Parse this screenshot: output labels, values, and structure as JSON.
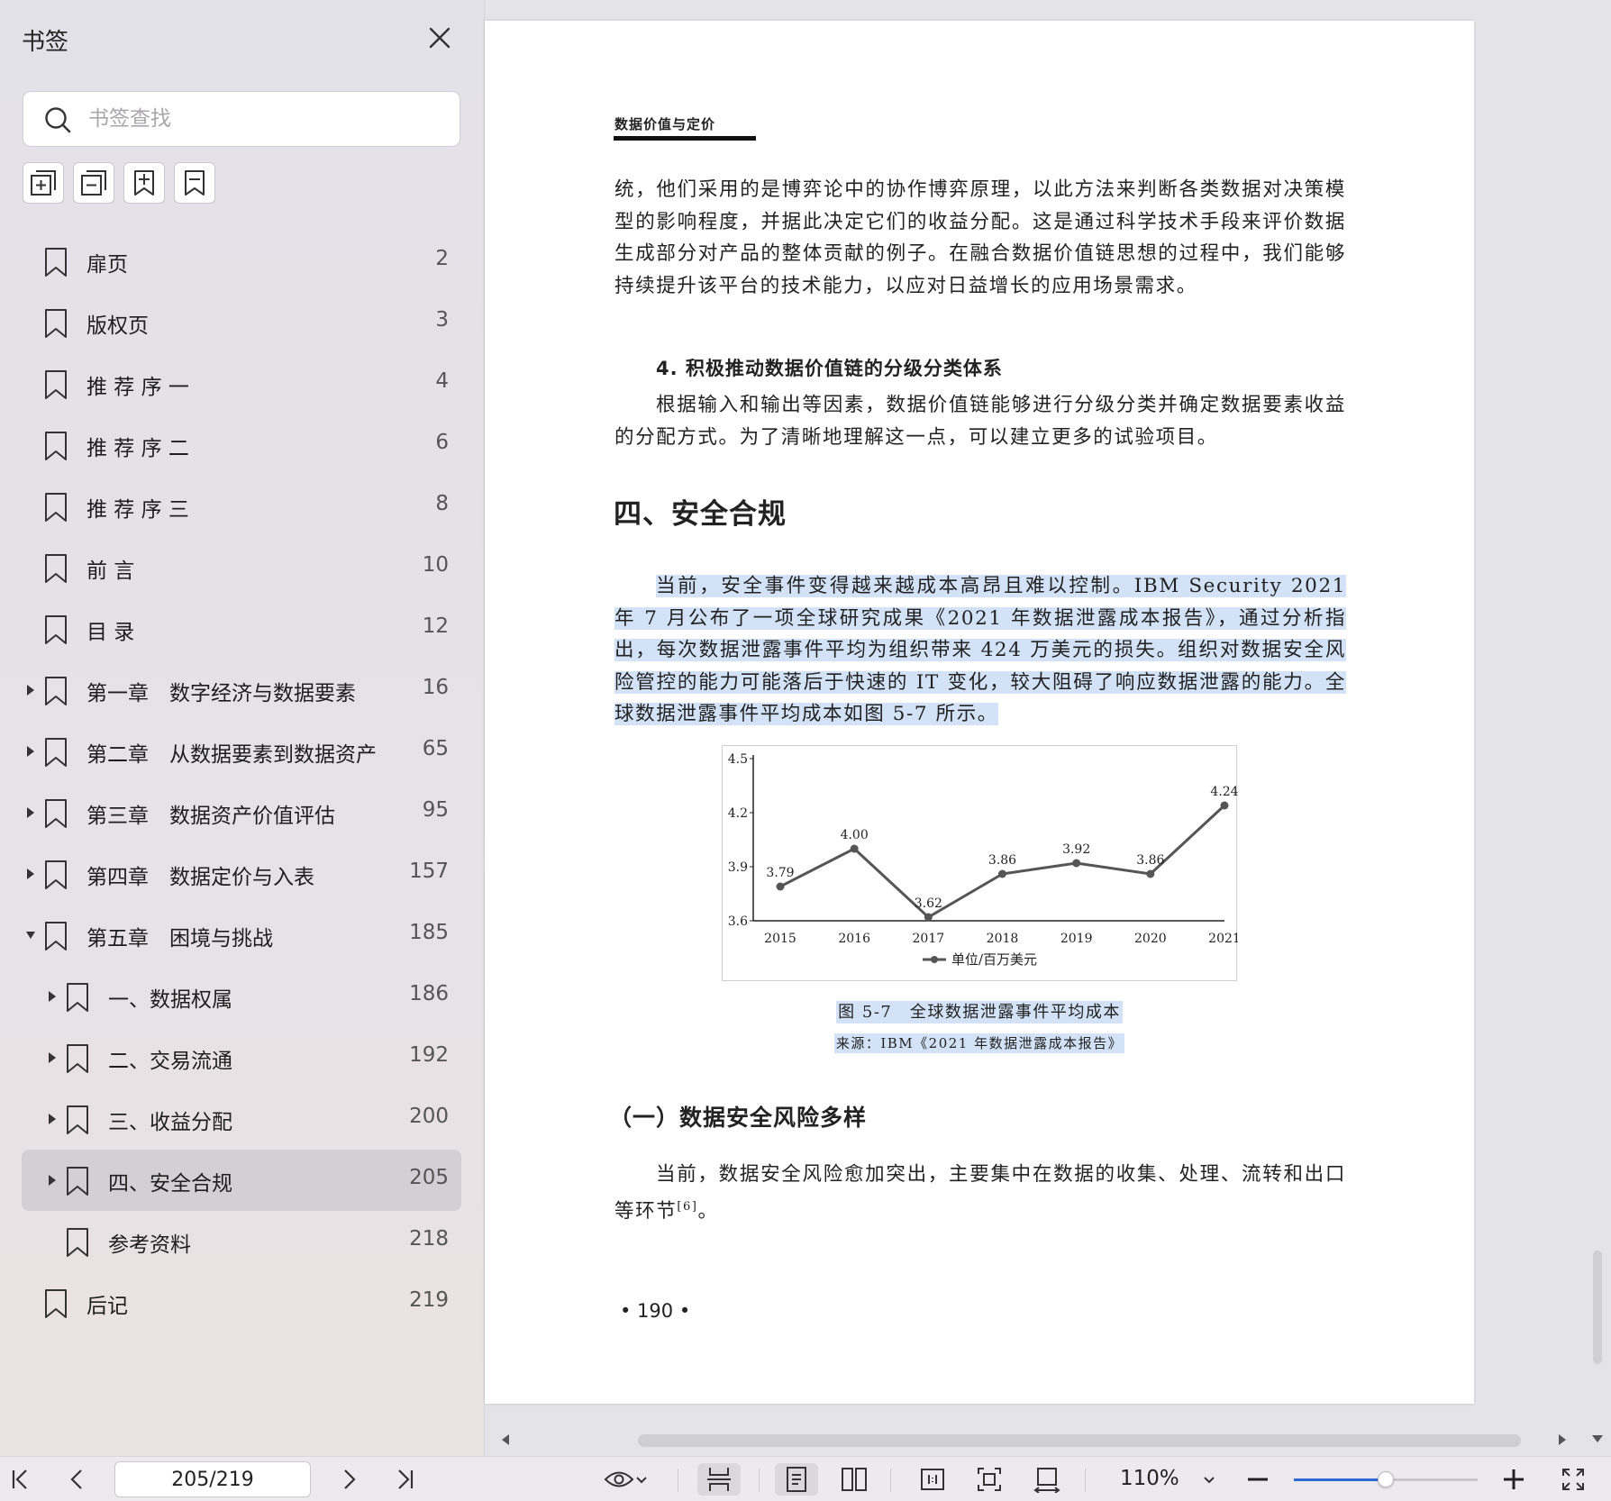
{
  "sidebar": {
    "title": "书签",
    "search_placeholder": "书签查找",
    "bookmarks": [
      {
        "label": "扉页",
        "page": "2",
        "level": 0,
        "arrow": "none"
      },
      {
        "label": "版权页",
        "page": "3",
        "level": 0,
        "arrow": "none"
      },
      {
        "label": "推 荐 序 一",
        "page": "4",
        "level": 0,
        "arrow": "none"
      },
      {
        "label": "推 荐 序 二",
        "page": "6",
        "level": 0,
        "arrow": "none"
      },
      {
        "label": "推 荐 序 三",
        "page": "8",
        "level": 0,
        "arrow": "none"
      },
      {
        "label": "前 言",
        "page": "10",
        "level": 0,
        "arrow": "none"
      },
      {
        "label": "目 录",
        "page": "12",
        "level": 0,
        "arrow": "none"
      },
      {
        "label": "第一章　数字经济与数据要素",
        "page": "16",
        "level": 0,
        "arrow": "right"
      },
      {
        "label": "第二章　从数据要素到数据资产",
        "page": "65",
        "level": 0,
        "arrow": "right"
      },
      {
        "label": "第三章　数据资产价值评估",
        "page": "95",
        "level": 0,
        "arrow": "right"
      },
      {
        "label": "第四章　数据定价与入表",
        "page": "157",
        "level": 0,
        "arrow": "right"
      },
      {
        "label": "第五章　困境与挑战",
        "page": "185",
        "level": 0,
        "arrow": "down"
      },
      {
        "label": "一、数据权属",
        "page": "186",
        "level": 1,
        "arrow": "right"
      },
      {
        "label": "二、交易流通",
        "page": "192",
        "level": 1,
        "arrow": "right"
      },
      {
        "label": "三、收益分配",
        "page": "200",
        "level": 1,
        "arrow": "right"
      },
      {
        "label": "四、安全合规",
        "page": "205",
        "level": 1,
        "arrow": "right",
        "selected": true
      },
      {
        "label": "参考资料",
        "page": "218",
        "level": 1,
        "arrow": "none"
      },
      {
        "label": "后记",
        "page": "219",
        "level": 0,
        "arrow": "none"
      }
    ]
  },
  "document": {
    "running_head": "数据价值与定价",
    "para1": "统，他们采用的是博弈论中的协作博弈原理，以此方法来判断各类数据对决策模型的影响程度，并据此决定它们的收益分配。这是通过科学技术手段来评价数据生成部分对产品的整体贡献的例子。在融合数据价值链思想的过程中，我们能够持续提升该平台的技术能力，以应对日益增长的应用场景需求。",
    "sub_heading_4": "4.  积极推动数据价值链的分级分类体系",
    "para2": "根据输入和输出等因素，数据价值链能够进行分级分类并确定数据要素收益的分配方式。为了清晰地理解这一点，可以建立更多的试验项目。",
    "section_heading": "四、安全合规",
    "para3": "当前，安全事件变得越来越成本高昂且难以控制。IBM Security 2021 年 7 月公布了一项全球研究成果《2021 年数据泄露成本报告》，通过分析指出，每次数据泄露事件平均为组织带来 424 万美元的损失。组织对数据安全风险管控的能力可能落后于快速的 IT 变化，较大阻碍了响应数据泄露的能力。全球数据泄露事件平均成本如图 5-7 所示。",
    "figure_caption": "图 5-7　全球数据泄露事件平均成本",
    "figure_source": "来源：IBM《2021 年数据泄露成本报告》",
    "subsection_heading": "（一）数据安全风险多样",
    "para4": "当前，数据安全风险愈加突出，主要集中在数据的收集、处理、流转和出口等环节",
    "para4_ref": "[6]",
    "para4_end": "。",
    "page_number": "• 190 •"
  },
  "chart_data": {
    "type": "line",
    "x": [
      "2015",
      "2016",
      "2017",
      "2018",
      "2019",
      "2020",
      "2021"
    ],
    "series": [
      {
        "name": "单位/百万美元",
        "values": [
          3.79,
          4.0,
          3.62,
          3.86,
          3.92,
          3.86,
          4.24
        ]
      }
    ],
    "data_labels": [
      "3.79",
      "4.00",
      "3.62",
      "3.86",
      "3.92",
      "3.86",
      "4.24"
    ],
    "yticks": [
      "3.6",
      "3.9",
      "4.2",
      "4.5"
    ],
    "ylim": [
      3.6,
      4.5
    ],
    "legend_position": "bottom",
    "grid": false,
    "line_color": "#555555"
  },
  "toolbar": {
    "page_indicator": "205/219",
    "zoom": "110%",
    "zoom_fraction": 0.5
  }
}
